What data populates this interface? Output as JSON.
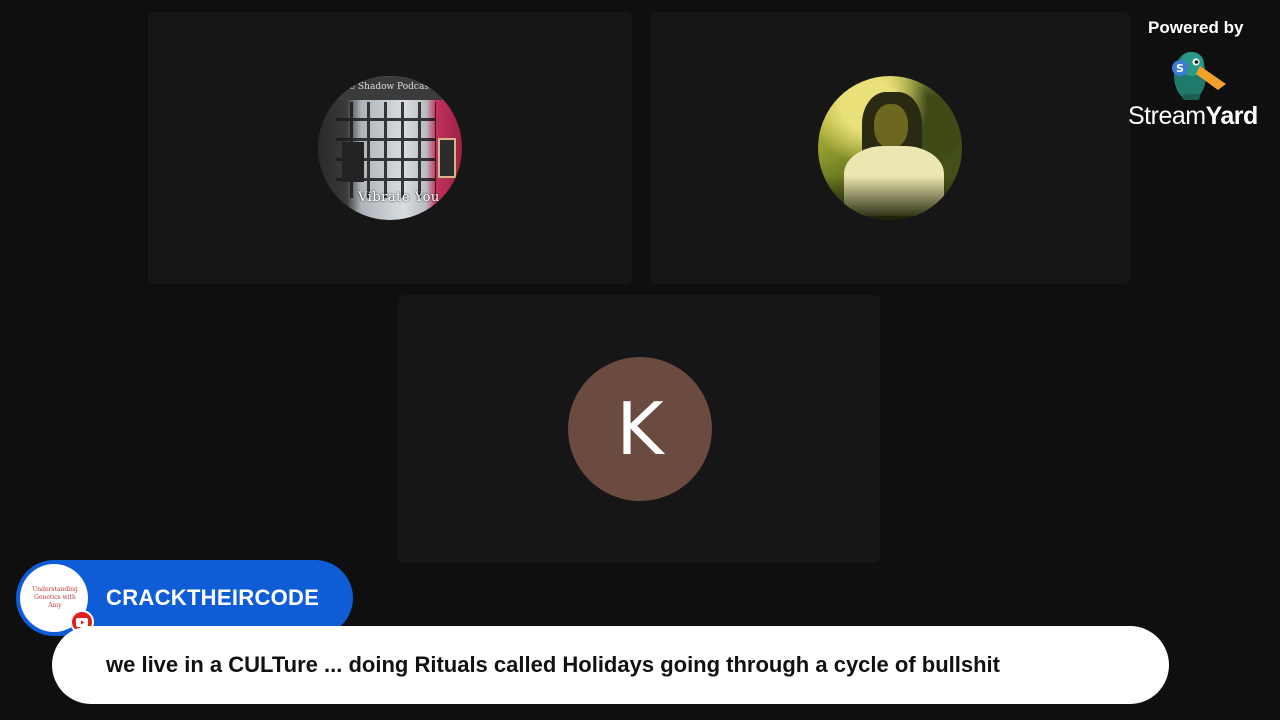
{
  "branding": {
    "powered_by": "Powered by",
    "wordmark_regular": "Stream",
    "wordmark_bold": "Yard"
  },
  "participants": [
    {
      "avatar_top_text": "The Shadow Podcast",
      "avatar_caption": "Vibrate You"
    },
    {
      "avatar": "photo"
    },
    {
      "avatar_initial": "K",
      "avatar_color": "#6b4a40"
    }
  ],
  "comment": {
    "author": "CRACKTHEIRCODE",
    "author_logo_text": "Understanding Genetics with Amy",
    "platform": "youtube-icon",
    "text": "we live in a CULTure ... doing Rituals called Holidays going through a cycle of bullshit"
  },
  "colors": {
    "background": "#0f0f0f",
    "tile": "#161616",
    "banner_blue": "#0f5cd7",
    "youtube_red": "#e02020"
  }
}
